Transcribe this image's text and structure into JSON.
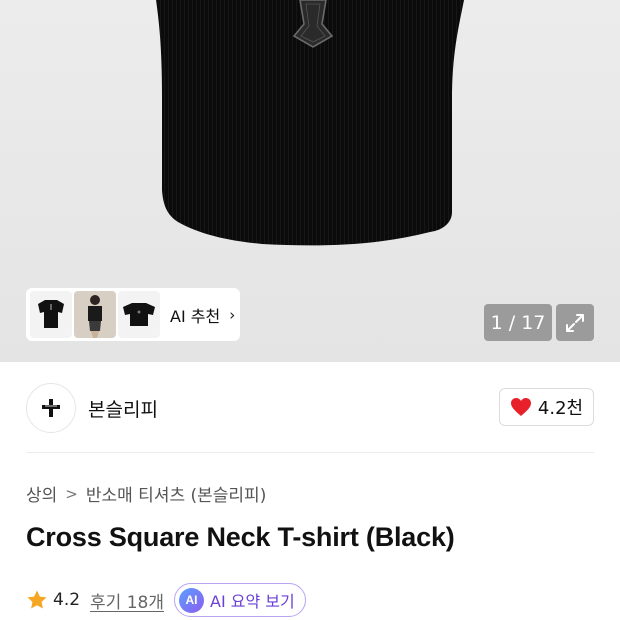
{
  "gallery": {
    "counter": "1 / 17",
    "ai_recommend_label": "AI 추천",
    "ai_recommend_chevron": "›",
    "thumbnails": [
      "shirt-front",
      "model-photo",
      "shirt-flat"
    ],
    "expand_icon": "expand-icon"
  },
  "brand": {
    "name": "본슬리피",
    "logo_icon": "cross-logo-icon",
    "likes": "4.2천"
  },
  "breadcrumb": {
    "items": [
      "상의",
      "반소매 티셔츠 (본슬리피)"
    ],
    "separator": ">"
  },
  "product": {
    "title": "Cross Square Neck T-shirt (Black)"
  },
  "rating": {
    "score": "4.2",
    "reviews_label": "후기 18개",
    "ai_badge": "AI",
    "ai_summary_label": "AI 요약 보기"
  },
  "colors": {
    "accent_purple": "#6b3fd6",
    "heart_red": "#e8202a",
    "star_orange": "#f5a623",
    "counter_bg": "#9b9b9b"
  }
}
